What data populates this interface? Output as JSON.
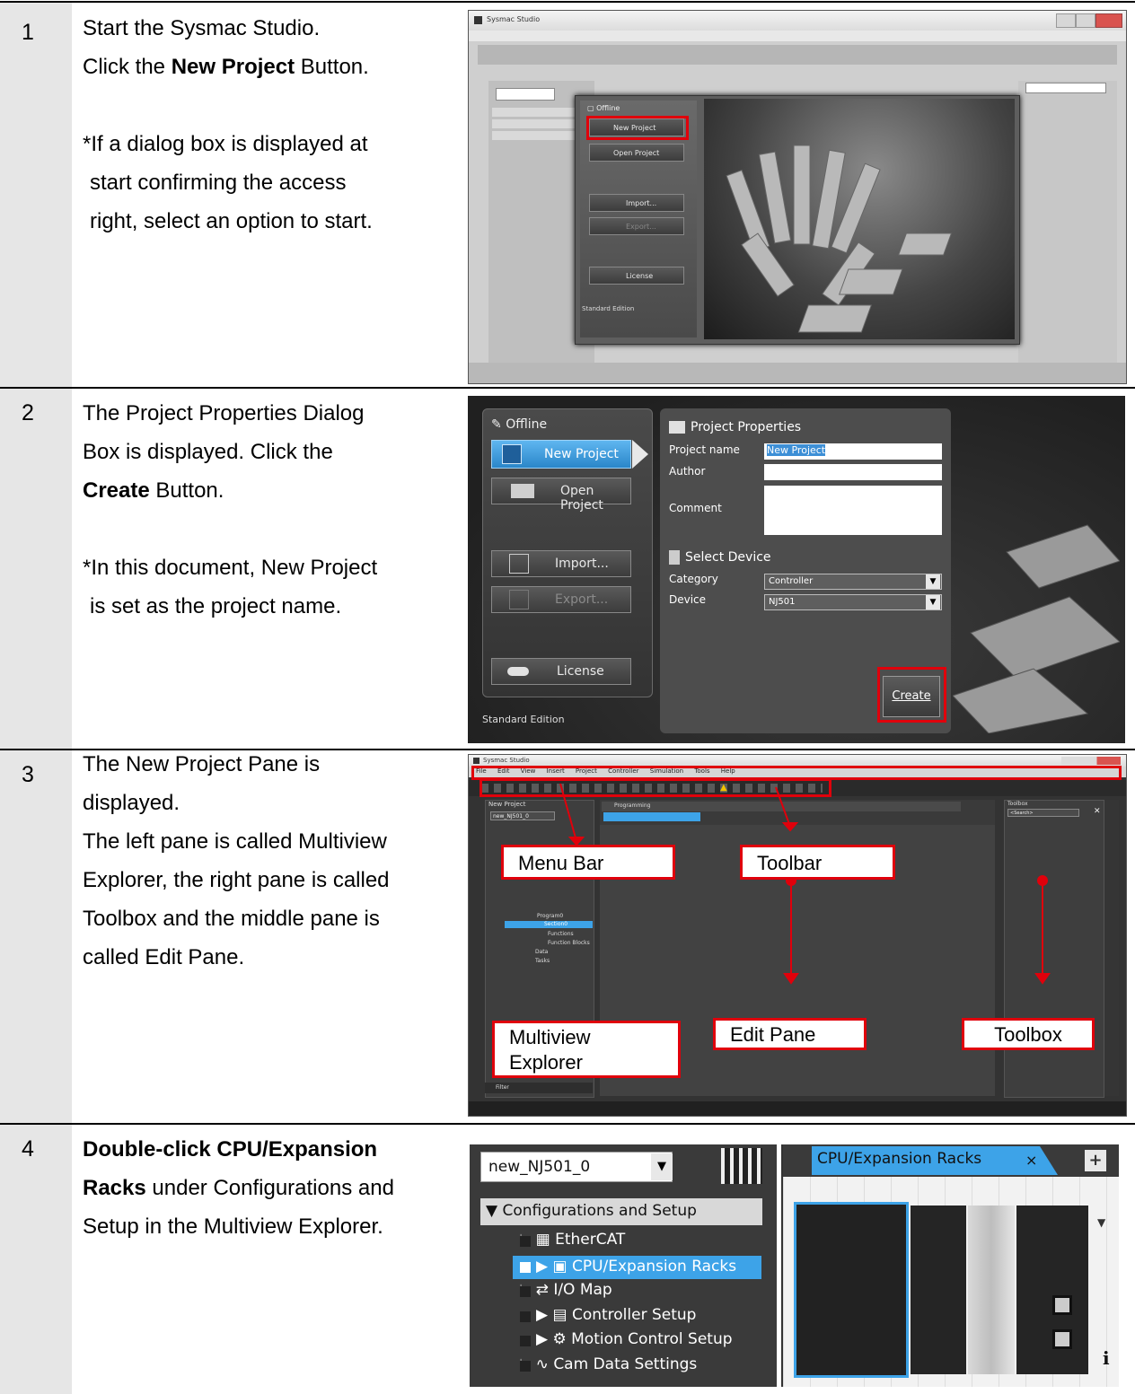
{
  "steps": [
    {
      "number": "1",
      "lines": [
        "Start the Sysmac Studio."
      ],
      "line2_pre": "Click the ",
      "line2_bold": "New Project",
      "line2_post": " Button.",
      "note": [
        "*If a dialog box is displayed at",
        "start confirming the access",
        "right, select an option to start."
      ]
    },
    {
      "number": "2",
      "line1": "The Project Properties Dialog",
      "line2": "Box is displayed. Click the",
      "line3_bold": "Create",
      "line3_post": " Button.",
      "note": [
        "*In this document, New Project",
        "is set as the project name."
      ]
    },
    {
      "number": "3",
      "lines": [
        "The New Project Pane is",
        "displayed.",
        "The left pane is called Multiview",
        "Explorer, the right pane is called",
        "Toolbox and the middle pane is",
        "called Edit Pane."
      ]
    },
    {
      "number": "4",
      "line1_bold": "Double-click ",
      "line1_b2": "CPU/Expansion",
      "line2_bold": "Racks",
      "line2_post": " under Configurations and",
      "line3": "Setup in the Multiview Explorer."
    }
  ],
  "shot1": {
    "window_title": "Sysmac Studio",
    "offline": "Offline",
    "new_project": "New Project",
    "open_project": "Open Project",
    "import": "Import...",
    "export": "Export...",
    "license": "License",
    "edition": "Standard Edition"
  },
  "shot2": {
    "offline": "Offline",
    "new_project": "New Project",
    "open_project": "Open Project",
    "import": "Import...",
    "export": "Export...",
    "license": "License",
    "edition": "Standard Edition",
    "panel_title": "Project Properties",
    "project_name_label": "Project name",
    "project_name_value": "New Project",
    "author_label": "Author",
    "comment_label": "Comment",
    "select_device": "Select Device",
    "category_label": "Category",
    "category_value": "Controller",
    "device_label": "Device",
    "device_value": "NJ501",
    "create": "Create"
  },
  "shot3": {
    "window_title": "Sysmac Studio",
    "menu": [
      "File",
      "Edit",
      "View",
      "Insert",
      "Project",
      "Controller",
      "Simulation",
      "Tools",
      "Help"
    ],
    "explorer_title": "New Project",
    "device_combo": "new_NJ501_0",
    "programming_tab": "Programming",
    "toolbox_title": "Toolbox",
    "search_placeholder": "<Search>",
    "tree": [
      "Program0",
      "Section0",
      "Functions",
      "Function Blocks",
      "Data",
      "Tasks"
    ],
    "side_label_left": "Multiview Explorer",
    "side_label_right": "Toolbox",
    "filter": "Filter",
    "callout_menubar": "Menu Bar",
    "callout_toolbar": "Toolbar",
    "callout_multiview_1": "Multiview",
    "callout_multiview_2": "Explorer",
    "callout_editpane": "Edit Pane",
    "callout_toolbox": "Toolbox"
  },
  "shot4": {
    "device_combo": "new_NJ501_0",
    "section": "Configurations and Setup",
    "items": [
      "EtherCAT",
      "CPU/Expansion Racks",
      "I/O Map",
      "Controller Setup",
      "Motion Control Setup",
      "Cam Data Settings"
    ],
    "tab_label": "CPU/Expansion Racks",
    "tab_close": "×",
    "add_label": "+",
    "info_label": "i"
  },
  "colors": {
    "red": "#e0000b",
    "select_blue": "#3da3e8",
    "row_gray": "#e6e6e6"
  }
}
